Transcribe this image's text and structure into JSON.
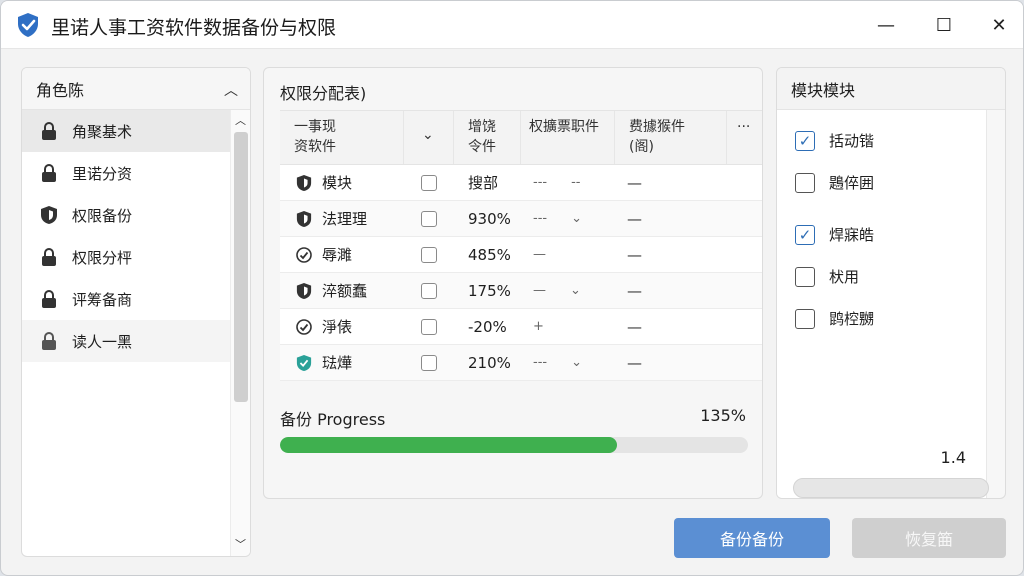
{
  "window": {
    "title": "里诺人事工资软件数据备份与权限",
    "minimize": "—",
    "maximize": "☐",
    "close": "✕"
  },
  "left_panel": {
    "title": "角色陈",
    "roles": [
      {
        "label": "角聚基术",
        "icon": "lock-icon"
      },
      {
        "label": "里诺分资",
        "icon": "lock-icon"
      },
      {
        "label": "权限备份",
        "icon": "shield-icon"
      },
      {
        "label": "权限分枰",
        "icon": "lock-icon"
      },
      {
        "label": "评筹备商",
        "icon": "lock-icon"
      },
      {
        "label": "读人一黑",
        "icon": "lock-icon"
      }
    ]
  },
  "center_panel": {
    "title": "权限分配表)",
    "headers": {
      "col1_line1": "一事现",
      "col1_line2": "资软件",
      "col2": "⌄",
      "col3_line1": "增饶",
      "col3_line2": "令件",
      "col4": "权擴票职件",
      "col5_line1": "费據猴件",
      "col5_line2": "(阁)",
      "col6": "···"
    },
    "rows": [
      {
        "name": "模块",
        "icon": "shield-icon",
        "value": "搜部",
        "c4": "---",
        "c4b": "--",
        "c5": "—"
      },
      {
        "name": "法理理",
        "icon": "shield-icon",
        "value": "930%",
        "c4": "---",
        "c4b": "⌄",
        "c5": "—"
      },
      {
        "name": "辱濉",
        "icon": "check-circle-icon",
        "value": "485%",
        "c4": "—",
        "c4b": "",
        "c5": "—"
      },
      {
        "name": "淬额蠢",
        "icon": "shield-icon",
        "value": "175%",
        "c4": "—",
        "c4b": "⌄",
        "c5": "—"
      },
      {
        "name": "淨俵",
        "icon": "check-circle-icon",
        "value": "-20%",
        "c4": "+",
        "c4b": "",
        "c5": "—"
      },
      {
        "name": "琺燁",
        "icon": "shield-check-icon",
        "value": "210%",
        "c4": "---",
        "c4b": "⌄",
        "c5": "—"
      }
    ],
    "progress": {
      "label": "备份 Progress",
      "value_text": "135%",
      "fill_fraction": 0.72
    }
  },
  "right_panel": {
    "title": "模块模块",
    "modules": [
      {
        "label": "括动锴",
        "checked": true
      },
      {
        "label": "鶗倅囲",
        "checked": false
      },
      {
        "label": "焊寐皓",
        "checked": true
      },
      {
        "label": "枤用",
        "checked": false
      },
      {
        "label": "鹍椌嬲",
        "checked": false
      }
    ],
    "value": "1.4"
  },
  "buttons": {
    "primary": "备份备份",
    "secondary": "恢复筁"
  },
  "colors": {
    "accent": "#5b8fd3",
    "progress": "#3fb04f",
    "check": "#2d6db5"
  }
}
